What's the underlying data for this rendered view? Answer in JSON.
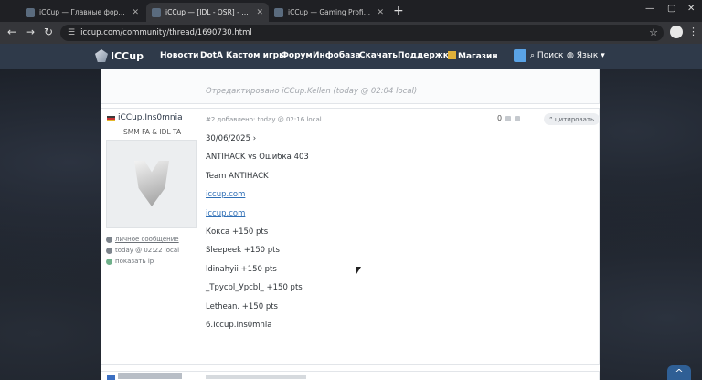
{
  "browser": {
    "tabs": [
      {
        "title": "iCCup — Главные форумы"
      },
      {
        "title": "iCCup — [IDL - OSR] - Отчёт п..."
      },
      {
        "title": "iCCup — Gaming Profile / Kita..."
      }
    ],
    "new_tab": "+",
    "window": {
      "minimize": "—",
      "maximize": "▢",
      "close": "✕"
    },
    "nav": {
      "back": "←",
      "forward": "→",
      "reload": "↻"
    },
    "url": "iccup.com/community/thread/1690730.html"
  },
  "site": {
    "logo": "ICCup",
    "menu": [
      "Новости",
      "DotA",
      "Кастом игры",
      "Форум",
      "Инфобаза",
      "Скачать",
      "Поддержка",
      "Магазин"
    ],
    "search": "Поиск",
    "lang": "Язык"
  },
  "prev_post": {
    "edited": "Отредактировано iCCup.Kellen (today @ 02:04 local)"
  },
  "post": {
    "username": "iCCup.Ins0mnia",
    "user_title": "SMM FA & IDL TA",
    "private_message": "личное сообщение",
    "last_seen": "today @ 02:22 local",
    "show_ip": "показать ip",
    "meta": "#2 добавлено: today @ 02:16 local",
    "votes": "0",
    "quote_label": "цитировать",
    "lines": [
      "30/06/2025 ›",
      "ANTIHACK vs Ошибка 403",
      "Team ANTIHACK",
      "iccup.com",
      "iccup.com",
      "Кокса +150 pts",
      "Sleepeek +150 pts",
      "ldinahyii +150 pts",
      "_Трусbl_Уpcbl_ +150 pts",
      "Lethean. +150 pts",
      "6.Iccup.Ins0mnia"
    ]
  },
  "scroll_top": "^"
}
